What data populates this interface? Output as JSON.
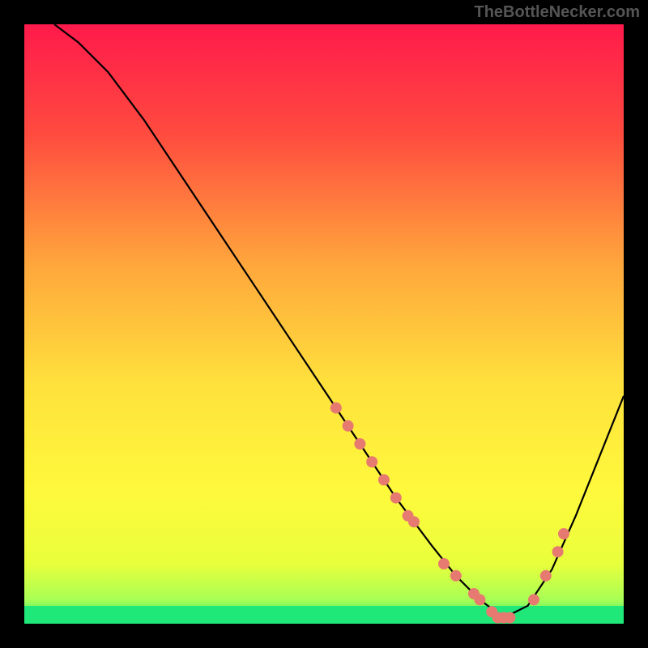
{
  "watermark": "TheBottleNecker.com",
  "chart_data": {
    "type": "line",
    "title": "",
    "xlabel": "",
    "ylabel": "",
    "xlim": [
      0,
      100
    ],
    "ylim": [
      0,
      100
    ],
    "grid": false,
    "background_gradient": [
      "#FF1A4B",
      "#FF5A3C",
      "#FFB43C",
      "#FFE13C",
      "#FFF93C",
      "#B8FF3C",
      "#1FE878"
    ],
    "series": [
      {
        "name": "bottleneck-curve",
        "color": "#000000",
        "x": [
          5,
          9,
          14,
          20,
          26,
          32,
          38,
          44,
          50,
          56,
          62,
          68,
          72,
          76,
          80,
          84,
          88,
          92,
          96,
          100
        ],
        "y": [
          100,
          97,
          92,
          84,
          75,
          66,
          57,
          48,
          39,
          30,
          21,
          13,
          8,
          4,
          1,
          3,
          9,
          18,
          28,
          38
        ]
      }
    ],
    "marker_points": {
      "name": "highlight-points",
      "color": "#E77A70",
      "x": [
        52,
        54,
        56,
        58,
        60,
        62,
        64,
        65,
        70,
        72,
        75,
        76,
        78,
        79,
        80,
        81,
        85,
        87,
        89,
        90
      ],
      "y": [
        36,
        33,
        30,
        27,
        24,
        21,
        18,
        17,
        10,
        8,
        5,
        4,
        2,
        1,
        1,
        1,
        4,
        8,
        12,
        15
      ]
    },
    "green_band": {
      "y_start": 0,
      "y_end": 3,
      "color": "#1FE878"
    }
  }
}
